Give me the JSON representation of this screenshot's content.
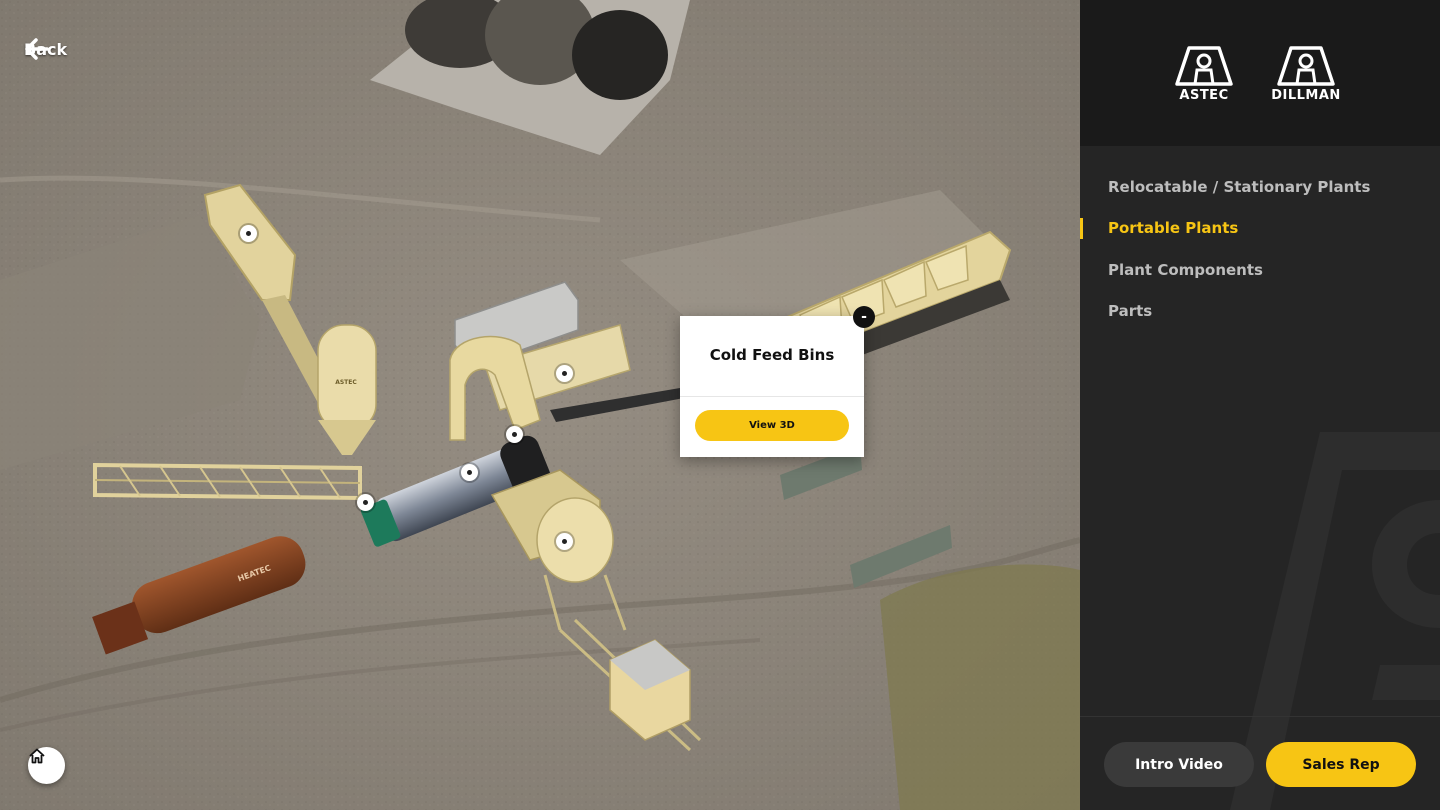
{
  "nav": {
    "back_label": "Back"
  },
  "popup": {
    "title": "Cold Feed Bins",
    "button_label": "View 3D",
    "close_label": "-"
  },
  "equipment_labels": {
    "silo_brand": "ASTEC",
    "tank_brand": "HEATEC"
  },
  "logos": [
    {
      "name": "ASTEC"
    },
    {
      "name": "DILLMAN"
    }
  ],
  "menu": {
    "items": [
      {
        "label": "Relocatable / Stationary Plants",
        "active": false
      },
      {
        "label": "Portable Plants",
        "active": true
      },
      {
        "label": "Plant Components",
        "active": false
      },
      {
        "label": "Parts",
        "active": false
      }
    ]
  },
  "footer": {
    "intro_label": "Intro Video",
    "sales_label": "Sales Rep"
  },
  "colors": {
    "accent": "#f7c514",
    "sidebar_bg": "#252525",
    "sidebar_top_bg": "#1a1a1a",
    "ground": "#8d857a",
    "equipment": "#e8d9a3"
  },
  "icons": {
    "back": "arrow-left-icon",
    "home": "home-icon",
    "hotspot": "hotspot-dot-icon"
  }
}
